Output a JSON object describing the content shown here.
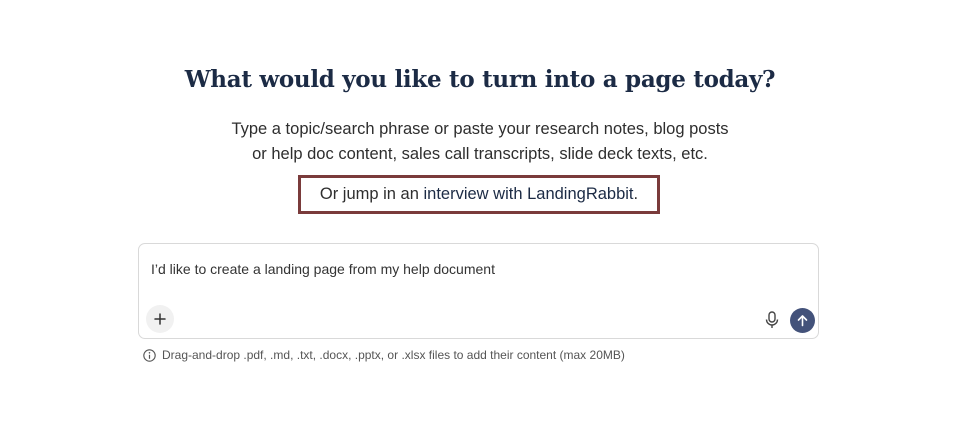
{
  "main": {
    "heading": "What would you like to turn into a page today?",
    "subtitle_line1": "Type a topic/search phrase or paste your research notes, blog posts",
    "subtitle_line2": "or help doc content, sales call transcripts, slide deck texts, etc.",
    "interview_prefix": "Or jump in an ",
    "interview_link": "interview with LandingRabbit",
    "interview_suffix": "."
  },
  "prompt": {
    "value": "I’d like to create a landing page from my help document",
    "add_icon": "plus-icon",
    "mic_icon": "microphone-icon",
    "send_icon": "arrow-up-icon",
    "send_color": "#43527a"
  },
  "hint": {
    "icon": "info-icon",
    "text": "Drag-and-drop .pdf, .md, .txt, .docx, .pptx, or .xlsx files to add their content (max 20MB)"
  },
  "colors": {
    "heading": "#1c2b45",
    "highlight_border": "#7a3b3b"
  }
}
